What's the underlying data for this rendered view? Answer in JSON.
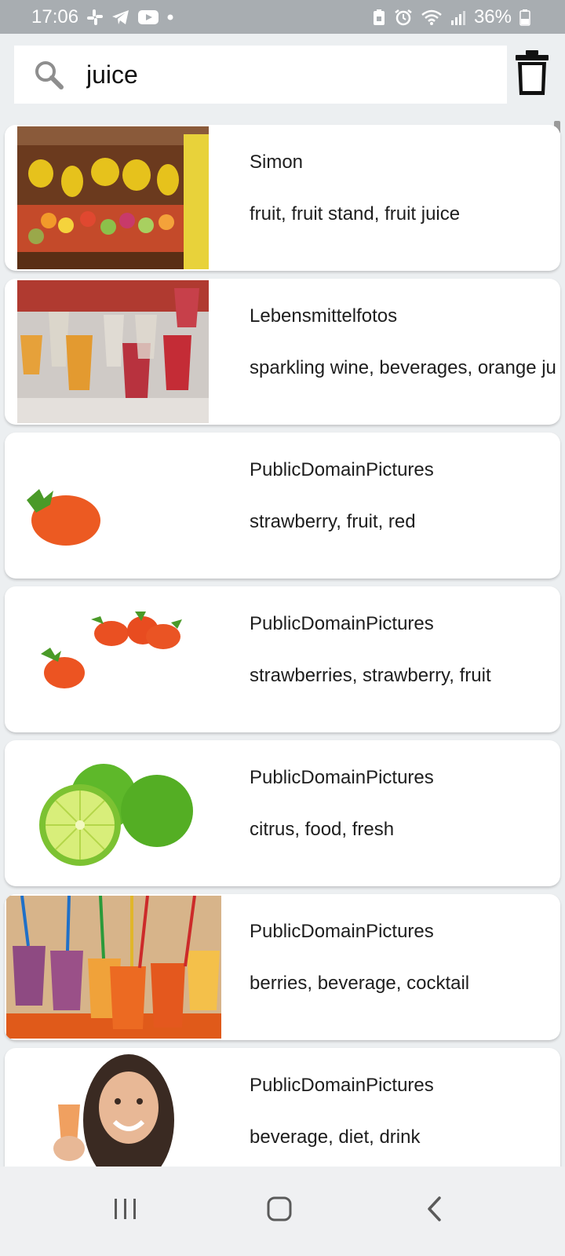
{
  "status_bar": {
    "time": "17:06",
    "battery": "36%",
    "left_icons": [
      "slack-icon",
      "telegram-icon",
      "youtube-icon",
      "dot-icon"
    ],
    "right_icons": [
      "lock-battery-icon",
      "alarm-icon",
      "wifi-icon",
      "signal-icon",
      "battery-icon"
    ]
  },
  "search": {
    "value": "juice"
  },
  "results": [
    {
      "user": "Simon",
      "tags": "fruit, fruit stand, fruit juice",
      "image": "fruit-stand-photo"
    },
    {
      "user": "Lebensmittelfotos",
      "tags": "sparkling wine, beverages, orange juice",
      "image": "champagne-glasses-photo"
    },
    {
      "user": "PublicDomainPictures",
      "tags": "strawberry, fruit, red",
      "image": "strawberry-photo"
    },
    {
      "user": "PublicDomainPictures",
      "tags": "strawberries, strawberry, fruit",
      "image": "strawberries-photo"
    },
    {
      "user": "PublicDomainPictures",
      "tags": "citrus, food, fresh",
      "image": "limes-photo"
    },
    {
      "user": "PublicDomainPictures",
      "tags": "berries, beverage, cocktail",
      "image": "smoothies-photo"
    },
    {
      "user": "PublicDomainPictures",
      "tags": "beverage, diet, drink",
      "image": "woman-juice-photo"
    }
  ],
  "nav_bar": {
    "buttons": [
      "recents-icon",
      "home-icon",
      "back-icon"
    ]
  },
  "colors": {
    "status_bar": "#a8adb1",
    "background": "#eceff1",
    "card": "#ffffff"
  }
}
